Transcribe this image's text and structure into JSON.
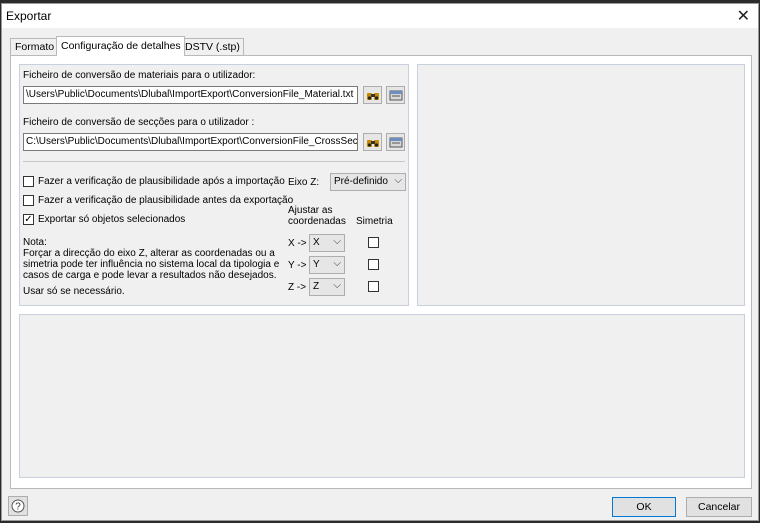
{
  "window": {
    "title": "Exportar",
    "close_glyph": "✕"
  },
  "tabs": [
    "Formato",
    "Configuração de detalhes",
    "DSTV (.stp)"
  ],
  "materials": {
    "label": "Ficheiro de conversão de materiais para o utilizador:",
    "path": "\\Users\\Public\\Documents\\Dlubal\\ImportExport\\ConversionFile_Material.txt"
  },
  "sections": {
    "label": "Ficheiro de conversão de secções para o utilizador :",
    "path": "C:\\Users\\Public\\Documents\\Dlubal\\ImportExport\\ConversionFile_CrossSect"
  },
  "options": {
    "check_import": {
      "label": "Fazer a verificação de plausibilidade após a importação",
      "checked": false
    },
    "check_export": {
      "label": "Fazer a verificação de plausibilidade antes da exportação",
      "checked": false
    },
    "export_selected": {
      "label": "Exportar só objetos selecionados",
      "checked": true,
      "mark": "✓"
    }
  },
  "z_axis": {
    "label": "Eixo Z:",
    "value": "Pré-definido"
  },
  "axes": {
    "adjust_header_1": "Ajustar as",
    "adjust_header_2": "coordenadas",
    "symmetry_header": "Simetria",
    "rows": [
      {
        "label": "X ->",
        "value": "X"
      },
      {
        "label": "Y ->",
        "value": "Y"
      },
      {
        "label": "Z ->",
        "value": "Z"
      }
    ]
  },
  "note": {
    "title": "Nota:",
    "line1": "Forçar a direcção do eixo Z, alterar as coordenadas ou a",
    "line2": "simetria pode ter influência no sistema local da tipologia e",
    "line3": "casos de carga e pode levar a resultados não desejados.",
    "line4": "Usar só se necessário."
  },
  "footer": {
    "ok": "OK",
    "cancel": "Cancelar",
    "help_icon": "help-icon"
  },
  "icons": {
    "binoculars": "binoculars-icon",
    "open": "open-file-icon",
    "dropdown": "chevron-down-icon"
  },
  "colors": {
    "panel_border": "#c8d0e0",
    "focus": "#0078d7"
  }
}
